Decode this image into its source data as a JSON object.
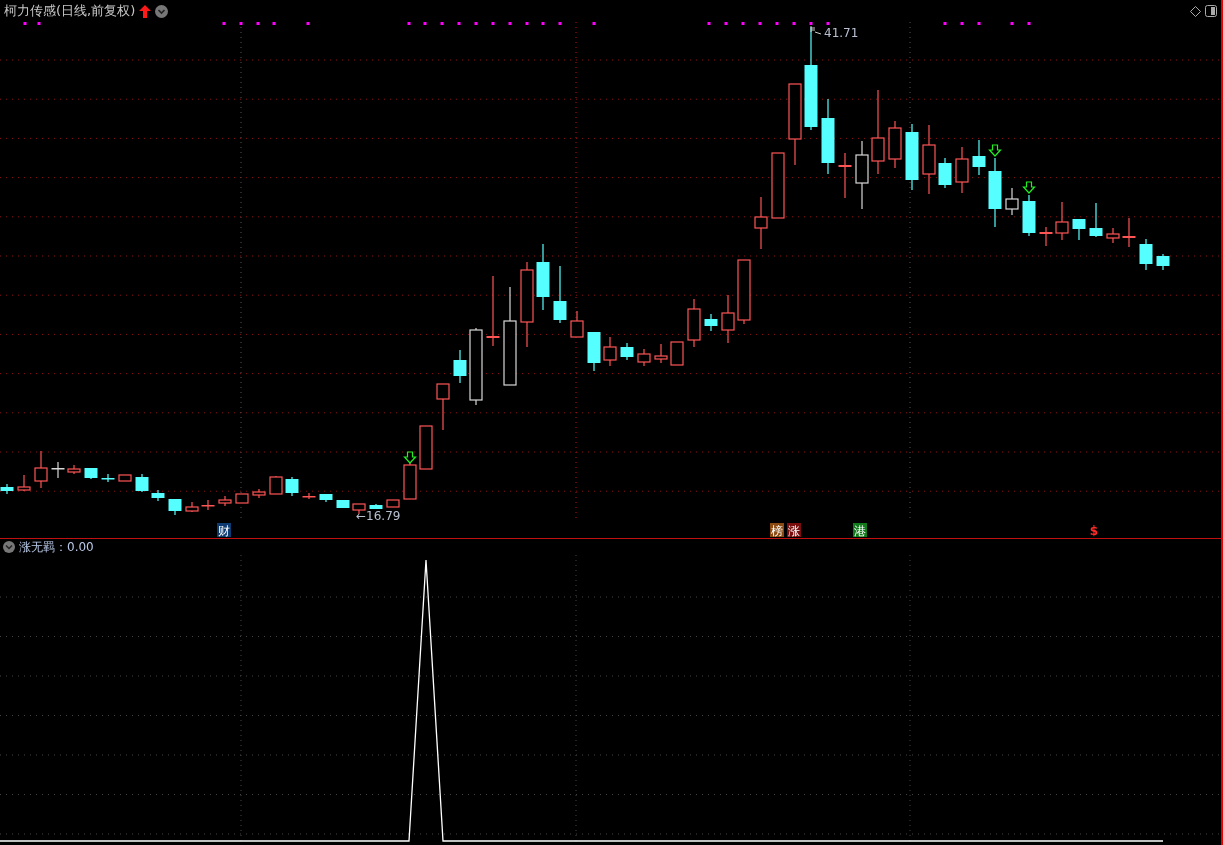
{
  "header": {
    "title": "柯力传感(日线,前复权)"
  },
  "price_chart": {
    "high_label": "41.71",
    "low_label": "←16.79",
    "events": [
      {
        "label": "财",
        "kind": "badge",
        "color": "#0d3a70"
      },
      {
        "label": "榜",
        "kind": "badge",
        "color": "#8a4a12"
      },
      {
        "label": "涨",
        "kind": "badge",
        "color": "#7a0e0e"
      },
      {
        "label": "港",
        "kind": "badge",
        "color": "#127a1c"
      },
      {
        "label": "$",
        "kind": "sign",
        "color": "#ff2a2a"
      }
    ]
  },
  "indicator": {
    "label": "涨无羁：0.00"
  }
}
